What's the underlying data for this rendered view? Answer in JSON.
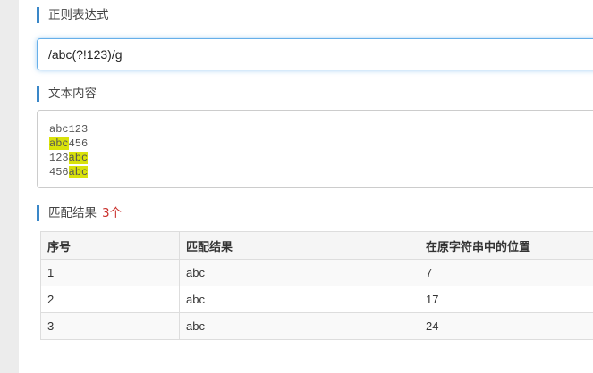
{
  "regex_section": {
    "heading": "正则表达式",
    "input_value": "/abc(?!123)/g"
  },
  "text_section": {
    "heading": "文本内容",
    "lines": [
      [
        {
          "text": "abc123",
          "highlight": false
        }
      ],
      [
        {
          "text": "abc",
          "highlight": true
        },
        {
          "text": "456",
          "highlight": false
        }
      ],
      [
        {
          "text": "123",
          "highlight": false
        },
        {
          "text": "abc",
          "highlight": true
        }
      ],
      [
        {
          "text": "456",
          "highlight": false
        },
        {
          "text": "abc",
          "highlight": true
        }
      ]
    ]
  },
  "result_section": {
    "heading": "匹配结果",
    "count": "3个",
    "columns": [
      "序号",
      "匹配结果",
      "在原字符串中的位置"
    ],
    "rows": [
      [
        "1",
        "abc",
        "7"
      ],
      [
        "2",
        "abc",
        "17"
      ],
      [
        "3",
        "abc",
        "24"
      ]
    ]
  },
  "colors": {
    "accent": "#3a87c8",
    "highlight": "#d9e20a",
    "count_red": "#c9302c"
  }
}
